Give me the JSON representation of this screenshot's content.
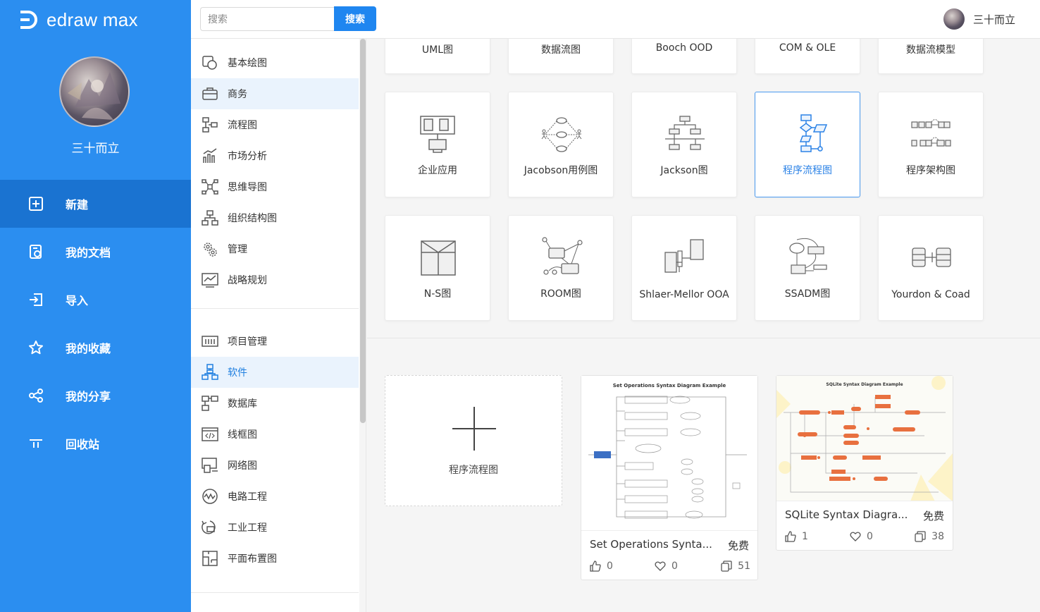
{
  "brand": {
    "name": "edraw max"
  },
  "sidebar": {
    "username": "三十而立",
    "nav": [
      {
        "label": "新建",
        "icon": "new-file-icon"
      },
      {
        "label": "我的文档",
        "icon": "my-docs-icon"
      },
      {
        "label": "导入",
        "icon": "import-icon"
      },
      {
        "label": "我的收藏",
        "icon": "star-icon"
      },
      {
        "label": "我的分享",
        "icon": "share-icon"
      },
      {
        "label": "回收站",
        "icon": "trash-icon"
      }
    ]
  },
  "topbar": {
    "search_placeholder": "搜索",
    "search_button": "搜索",
    "username": "三十而立"
  },
  "categories": {
    "group1": [
      {
        "label": "基本绘图",
        "icon": "basic-drawing-icon"
      },
      {
        "label": "商务",
        "icon": "briefcase-icon"
      },
      {
        "label": "流程图",
        "icon": "flowchart-icon"
      },
      {
        "label": "市场分析",
        "icon": "bar-chart-icon"
      },
      {
        "label": "思维导图",
        "icon": "mindmap-icon"
      },
      {
        "label": "组织结构图",
        "icon": "org-chart-icon"
      },
      {
        "label": "管理",
        "icon": "gears-icon"
      },
      {
        "label": "战略规划",
        "icon": "strategy-icon"
      }
    ],
    "group2": [
      {
        "label": "项目管理",
        "icon": "project-icon"
      },
      {
        "label": "软件",
        "icon": "software-icon"
      },
      {
        "label": "数据库",
        "icon": "database-icon"
      },
      {
        "label": "线框图",
        "icon": "wireframe-icon"
      },
      {
        "label": "网络图",
        "icon": "network-icon"
      },
      {
        "label": "电路工程",
        "icon": "circuit-icon"
      },
      {
        "label": "工业工程",
        "icon": "industrial-icon"
      },
      {
        "label": "平面布置图",
        "icon": "floorplan-icon"
      }
    ]
  },
  "templates": {
    "row0": [
      "UML图",
      "数据流图",
      "Booch OOD",
      "COM & OLE",
      "数据流模型"
    ],
    "row1": [
      "企业应用",
      "Jacobson用例图",
      "Jackson图",
      "程序流程图",
      "程序架构图"
    ],
    "row2": [
      "N-S图",
      "ROOM图",
      "Shlaer-Mellor OOA",
      "SSADM图",
      "Yourdon & Coad"
    ]
  },
  "new_card": {
    "label": "程序流程图"
  },
  "examples": [
    {
      "title": "Set Operations Synta...",
      "thumb_title": "Set Operations Syntax Diagram Example",
      "price": "免费",
      "likes": "0",
      "favorites": "0",
      "copies": "51"
    },
    {
      "title": "SQLite Syntax Diagra...",
      "thumb_title": "SQLite Syntax Diagram Example",
      "price": "免费",
      "likes": "1",
      "favorites": "0",
      "copies": "38"
    }
  ],
  "colors": {
    "brand": "#2b8ef0",
    "nav_active": "#1a73d1",
    "accent": "#1f86f0",
    "category_active_bg": "#eaf3fd"
  }
}
